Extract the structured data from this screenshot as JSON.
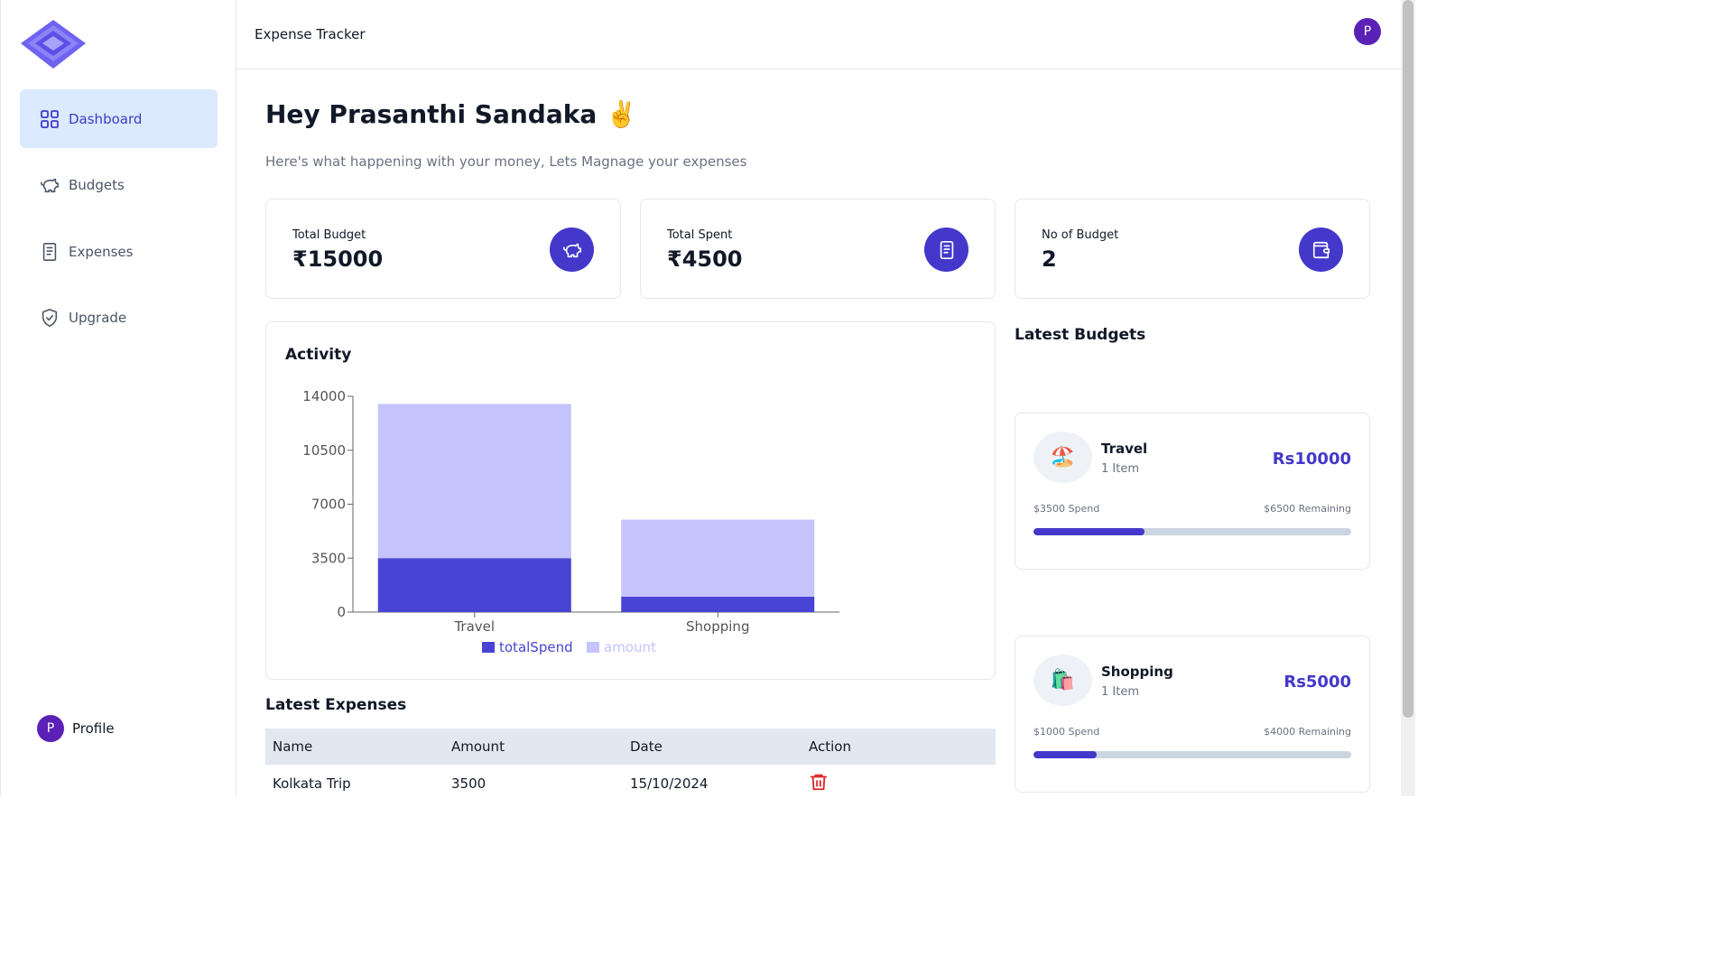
{
  "header": {
    "title": "Expense Tracker",
    "avatar_letter": "P"
  },
  "sidebar": {
    "items": [
      {
        "label": "Dashboard",
        "icon": "grid-icon",
        "active": true
      },
      {
        "label": "Budgets",
        "icon": "piggy-bank-icon",
        "active": false
      },
      {
        "label": "Expenses",
        "icon": "receipt-icon",
        "active": false
      },
      {
        "label": "Upgrade",
        "icon": "shield-check-icon",
        "active": false
      }
    ],
    "profile": {
      "letter": "P",
      "label": "Profile"
    }
  },
  "main": {
    "greeting": "Hey Prasanthi Sandaka ✌️",
    "subtitle": "Here's what happening with your money, Lets Magnage your expenses",
    "stats": [
      {
        "label": "Total Budget",
        "value": "₹15000",
        "icon": "piggy-bank-icon"
      },
      {
        "label": "Total Spent",
        "value": "₹4500",
        "icon": "receipt-icon"
      },
      {
        "label": "No of Budget",
        "value": "2",
        "icon": "wallet-icon"
      }
    ],
    "activity_title": "Activity",
    "latest_expenses_title": "Latest Expenses",
    "expenses_table": {
      "headers": [
        "Name",
        "Amount",
        "Date",
        "Action"
      ],
      "rows": [
        {
          "name": "Kolkata Trip",
          "amount": "3500",
          "date": "15/10/2024",
          "action_icon": "trash-icon"
        }
      ]
    },
    "latest_budgets_title": "Latest Budgets",
    "budgets": [
      {
        "emoji": "🏖️",
        "name": "Travel",
        "items": "1 Item",
        "amount": "Rs10000",
        "spend": "$3500 Spend",
        "remaining": "$6500 Remaining",
        "progress": 0.35
      },
      {
        "emoji": "🛍️",
        "name": "Shopping",
        "items": "1 Item",
        "amount": "Rs5000",
        "spend": "$1000 Spend",
        "remaining": "$4000 Remaining",
        "progress": 0.2
      }
    ]
  },
  "colors": {
    "primary": "#4338ca",
    "amount_bar": "#c4c3fb",
    "spend_bar": "#4844d4",
    "active_nav_bg": "#dbeafe"
  },
  "chart_data": {
    "type": "bar",
    "stacked": true,
    "categories": [
      "Travel",
      "Shopping"
    ],
    "series": [
      {
        "name": "totalSpend",
        "values": [
          3500,
          1000
        ],
        "color": "#4844d4"
      },
      {
        "name": "amount",
        "values": [
          10000,
          5000
        ],
        "color": "#c4c3fb"
      }
    ],
    "yticks": [
      0,
      3500,
      7000,
      10500,
      14000
    ],
    "ylim": [
      0,
      14000
    ],
    "legend": "bottom"
  }
}
